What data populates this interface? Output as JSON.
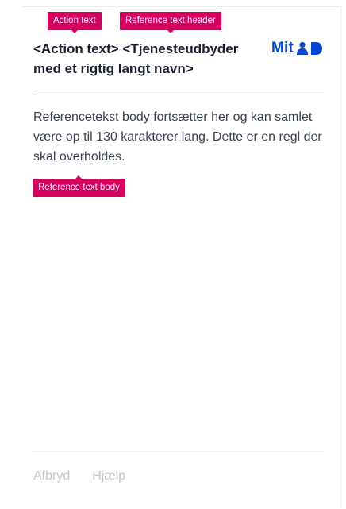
{
  "annotations": {
    "action_text": "Action text",
    "reference_text_header": "Reference text header",
    "reference_text_body": "Reference text body"
  },
  "header": {
    "title": "<Action text> <Tjenesteudbyder med et rigtig langt navn>",
    "logo_text": "Mit",
    "logo_icon": "mitid-logo-icon"
  },
  "body": {
    "text": "Referencetekst body fortsætter her og kan samlet være op til 130 karakterer lang. Dette er en regl der skal overholdes."
  },
  "footer": {
    "cancel_label": "Afbryd",
    "help_label": "Hjælp"
  },
  "colors": {
    "accent": "#0048d4",
    "annotation": "#d6005f",
    "footer_link": "#c2c6cc"
  }
}
